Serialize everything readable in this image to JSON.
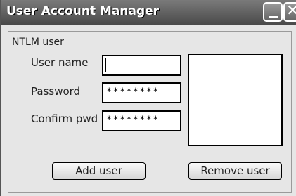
{
  "window": {
    "title": "User Account Manager"
  },
  "titlebar": {
    "minimize_icon": "minimize-icon",
    "close_icon": "close-icon",
    "close_glyph": "✕"
  },
  "form": {
    "group_label": "NTLM user",
    "username_label": "User name",
    "username_value": "",
    "password_label": "Password",
    "password_value": "********",
    "confirm_label": "Confirm pwd",
    "confirm_value": "********"
  },
  "buttons": {
    "add": "Add user",
    "remove": "Remove user"
  },
  "users_list": {
    "items": []
  }
}
